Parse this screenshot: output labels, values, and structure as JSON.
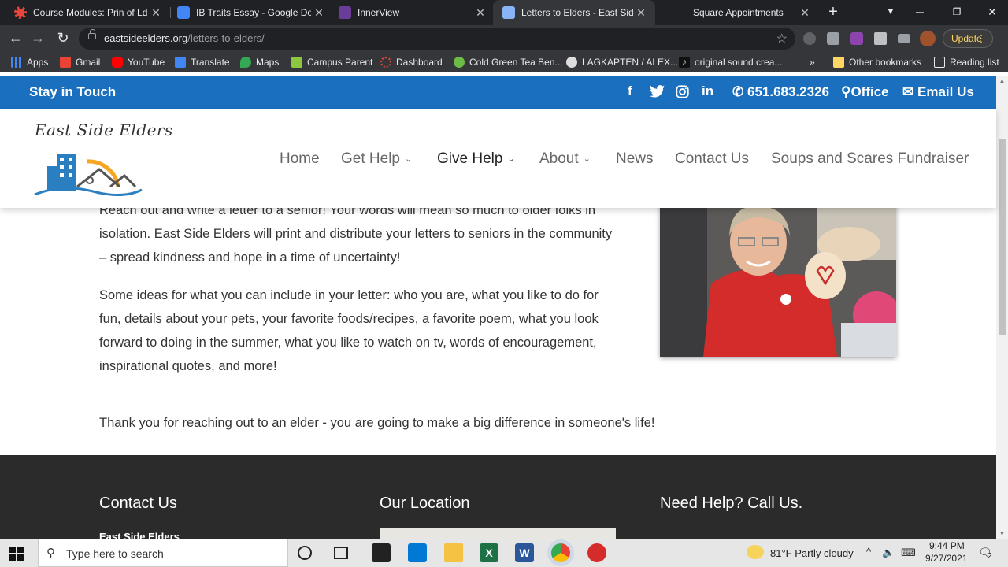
{
  "browser": {
    "tabs": [
      {
        "title": "Course Modules: Prin of Ldrshp",
        "icon_color": "#e8453c",
        "icon": "canvas-icon"
      },
      {
        "title": "IB Traits Essay - Google Docs",
        "icon_color": "#4285f4",
        "icon": "docs-icon"
      },
      {
        "title": "InnerView",
        "icon_color": "#6a3d9a",
        "icon": "innerview-icon"
      },
      {
        "title": "Letters to Elders - East Side Elders",
        "icon_color": "#8ab4f8",
        "icon": "site-icon"
      },
      {
        "title": "Square Appointments",
        "icon_color": "#202124",
        "icon": "square-icon"
      }
    ],
    "url_host": "eastsideelders.org",
    "url_path": "/letters-to-elders/",
    "update_label": "Update",
    "bookmarks": [
      {
        "label": "Apps",
        "color": "#4285f4"
      },
      {
        "label": "Gmail",
        "color": "#ea4335"
      },
      {
        "label": "YouTube",
        "color": "#ff0000"
      },
      {
        "label": "Translate",
        "color": "#4285f4"
      },
      {
        "label": "Maps",
        "color": "#34a853"
      },
      {
        "label": "Campus Parent",
        "color": "#8dc63f"
      },
      {
        "label": "Dashboard",
        "color": "#e8453c"
      },
      {
        "label": "Cold Green Tea Ben...",
        "color": "#6dbb45"
      },
      {
        "label": "LAGKAPTEN / ALEX...",
        "color": "#dddddd"
      },
      {
        "label": "original sound crea...",
        "color": "#111111"
      }
    ],
    "more_bookmarks": "»",
    "other_bookmarks": "Other bookmarks",
    "reading_list": "Reading list"
  },
  "site": {
    "topbar": {
      "stay_in_touch": "Stay in Touch",
      "social": [
        "f",
        "twitter",
        "instagram",
        "in"
      ],
      "phone": "651.683.2326",
      "office": "Office",
      "email": "Email Us"
    },
    "logo_text": "East Side Elders",
    "nav": [
      {
        "label": "Home",
        "dropdown": false
      },
      {
        "label": "Get Help",
        "dropdown": true
      },
      {
        "label": "Give Help",
        "dropdown": true,
        "active": true
      },
      {
        "label": "About",
        "dropdown": true
      },
      {
        "label": "News",
        "dropdown": false
      },
      {
        "label": "Contact Us",
        "dropdown": false
      },
      {
        "label": "Soups and Scares Fundraiser",
        "dropdown": false
      }
    ],
    "content": {
      "para1": "Reach out and write a letter to a senior!  Your words will mean so much to older folks in isolation.  East Side Elders will print and distribute your letters to seniors in the community – spread kindness and hope in a time of uncertainty!",
      "para2": "Some ideas for what you can include in your letter:  who you are, what you like to do for fun, details about your pets, your favorite foods/recipes, a favorite poem, what you look forward to doing in the summer, what you like to watch on tv, words of encouragement, inspirational quotes, and more!",
      "para3": "Thank you for reaching out to an elder - you are going to make a big difference in someone's life!"
    },
    "footer": {
      "contact_heading": "Contact Us",
      "contact_sub": "East Side Elders",
      "location_heading": "Our Location",
      "help_heading": "Need Help?  Call Us."
    }
  },
  "taskbar": {
    "search_placeholder": "Type here to search",
    "weather": "81°F  Partly cloudy",
    "time": "9:44 PM",
    "date": "9/27/2021",
    "notifications": "2"
  }
}
